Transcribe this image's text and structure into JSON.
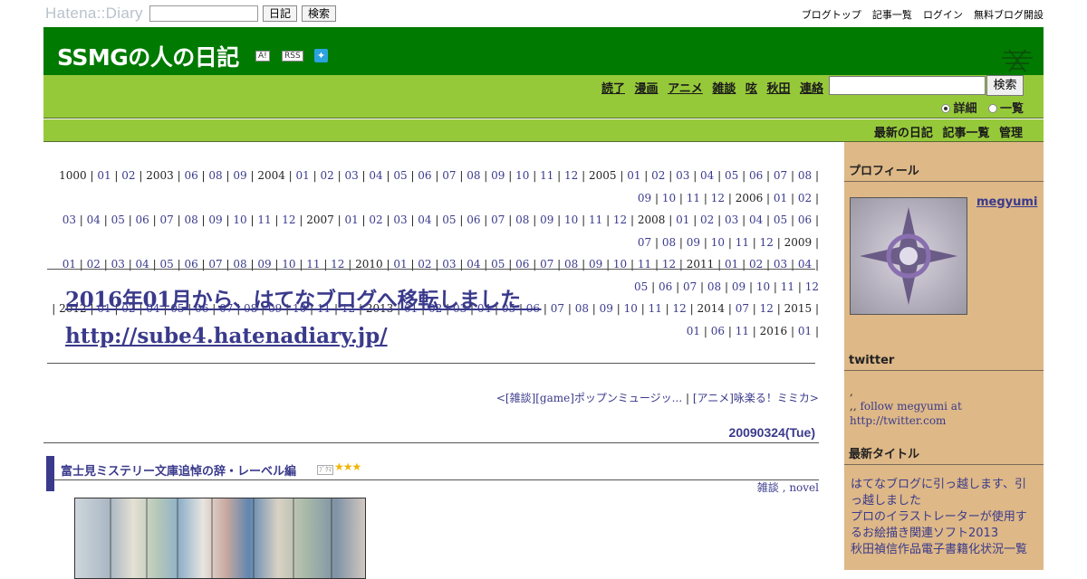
{
  "topbar": {
    "logo": "Hatena::Diary",
    "search_value": "",
    "diary_btn": "日記",
    "search_btn": "検索",
    "links": [
      "ブログトップ",
      "記事一覧",
      "ログイン",
      "無料ブログ開設"
    ]
  },
  "header": {
    "title": "SSMGの人の日記",
    "icon_a": "A!",
    "icon_rss": "RSS",
    "twitter_icon": "twitter-bird"
  },
  "nav": {
    "categories": [
      "読了",
      "漫画",
      "アニメ",
      "雑談",
      "呟",
      "秋田",
      "連絡"
    ],
    "search_value": "",
    "search_btn": "検索",
    "radio_detail": "詳細",
    "radio_list": "一覧",
    "selected_radio": "詳細"
  },
  "subnav": {
    "links": [
      "最新の日記",
      "記事一覧",
      "管理"
    ]
  },
  "calendar": {
    "lines": [
      [
        {
          "t": "1000 | "
        },
        {
          "a": "01"
        },
        {
          "t": " | "
        },
        {
          "a": "02"
        },
        {
          "t": " | 2003 | "
        },
        {
          "a": "06"
        },
        {
          "t": " | "
        },
        {
          "a": "08"
        },
        {
          "t": " | "
        },
        {
          "a": "09"
        },
        {
          "t": " | 2004 | "
        },
        {
          "a": "01"
        },
        {
          "t": " | "
        },
        {
          "a": "02"
        },
        {
          "t": " | "
        },
        {
          "a": "03"
        },
        {
          "t": " | "
        },
        {
          "a": "04"
        },
        {
          "t": " | "
        },
        {
          "a": "05"
        },
        {
          "t": " | "
        },
        {
          "a": "06"
        },
        {
          "t": " | "
        },
        {
          "a": "07"
        },
        {
          "t": " | "
        },
        {
          "a": "08"
        },
        {
          "t": " | "
        },
        {
          "a": "09"
        },
        {
          "t": " | "
        },
        {
          "a": "10"
        },
        {
          "t": " | "
        },
        {
          "a": "11"
        },
        {
          "t": " | "
        },
        {
          "a": "12"
        },
        {
          "t": " | 2005 | "
        },
        {
          "a": "01"
        },
        {
          "t": " | "
        },
        {
          "a": "02"
        },
        {
          "t": " | "
        },
        {
          "a": "03"
        },
        {
          "t": " | "
        },
        {
          "a": "04"
        },
        {
          "t": " | "
        },
        {
          "a": "05"
        },
        {
          "t": " | "
        },
        {
          "a": "06"
        },
        {
          "t": " | "
        },
        {
          "a": "07"
        },
        {
          "t": " | "
        },
        {
          "a": "08"
        },
        {
          "t": " | "
        },
        {
          "a": "09"
        },
        {
          "t": " | "
        },
        {
          "a": "10"
        },
        {
          "t": " | "
        },
        {
          "a": "11"
        },
        {
          "t": " | "
        },
        {
          "a": "12"
        },
        {
          "t": " | 2006 | "
        },
        {
          "a": "01"
        },
        {
          "t": " | "
        },
        {
          "a": "02"
        },
        {
          "t": " |"
        }
      ],
      [
        {
          "a": "03"
        },
        {
          "t": " | "
        },
        {
          "a": "04"
        },
        {
          "t": " | "
        },
        {
          "a": "05"
        },
        {
          "t": " | "
        },
        {
          "a": "06"
        },
        {
          "t": " | "
        },
        {
          "a": "07"
        },
        {
          "t": " | "
        },
        {
          "a": "08"
        },
        {
          "t": " | "
        },
        {
          "a": "09"
        },
        {
          "t": " | "
        },
        {
          "a": "10"
        },
        {
          "t": " | "
        },
        {
          "a": "11"
        },
        {
          "t": " | "
        },
        {
          "a": "12"
        },
        {
          "t": " | 2007 | "
        },
        {
          "a": "01"
        },
        {
          "t": " | "
        },
        {
          "a": "02"
        },
        {
          "t": " | "
        },
        {
          "a": "03"
        },
        {
          "t": " | "
        },
        {
          "a": "04"
        },
        {
          "t": " | "
        },
        {
          "a": "05"
        },
        {
          "t": " | "
        },
        {
          "a": "06"
        },
        {
          "t": " | "
        },
        {
          "a": "07"
        },
        {
          "t": " | "
        },
        {
          "a": "08"
        },
        {
          "t": " | "
        },
        {
          "a": "09"
        },
        {
          "t": " | "
        },
        {
          "a": "10"
        },
        {
          "t": " | "
        },
        {
          "a": "11"
        },
        {
          "t": " | "
        },
        {
          "a": "12"
        },
        {
          "t": " | 2008 | "
        },
        {
          "a": "01"
        },
        {
          "t": " | "
        },
        {
          "a": "02"
        },
        {
          "t": " | "
        },
        {
          "a": "03"
        },
        {
          "t": " | "
        },
        {
          "a": "04"
        },
        {
          "t": " | "
        },
        {
          "a": "05"
        },
        {
          "t": " | "
        },
        {
          "a": "06"
        },
        {
          "t": " | "
        },
        {
          "a": "07"
        },
        {
          "t": " | "
        },
        {
          "a": "08"
        },
        {
          "t": " | "
        },
        {
          "a": "09"
        },
        {
          "t": " | "
        },
        {
          "a": "10"
        },
        {
          "t": " | "
        },
        {
          "a": "11"
        },
        {
          "t": " | "
        },
        {
          "a": "12"
        },
        {
          "t": " | 2009 |"
        }
      ],
      [
        {
          "a": "01"
        },
        {
          "t": " | "
        },
        {
          "a": "02"
        },
        {
          "t": " | "
        },
        {
          "a": "03"
        },
        {
          "t": " | "
        },
        {
          "a": "04"
        },
        {
          "t": " | "
        },
        {
          "a": "05"
        },
        {
          "t": " | "
        },
        {
          "a": "06"
        },
        {
          "t": " | "
        },
        {
          "a": "07"
        },
        {
          "t": " | "
        },
        {
          "a": "08"
        },
        {
          "t": " | "
        },
        {
          "a": "09"
        },
        {
          "t": " | "
        },
        {
          "a": "10"
        },
        {
          "t": " | "
        },
        {
          "a": "11"
        },
        {
          "t": " | "
        },
        {
          "a": "12"
        },
        {
          "t": " | 2010 | "
        },
        {
          "a": "01"
        },
        {
          "t": " | "
        },
        {
          "a": "02"
        },
        {
          "t": " | "
        },
        {
          "a": "03"
        },
        {
          "t": " | "
        },
        {
          "a": "04"
        },
        {
          "t": " | "
        },
        {
          "a": "05"
        },
        {
          "t": " | "
        },
        {
          "a": "06"
        },
        {
          "t": " | "
        },
        {
          "a": "07"
        },
        {
          "t": " | "
        },
        {
          "a": "08"
        },
        {
          "t": " | "
        },
        {
          "a": "09"
        },
        {
          "t": " | "
        },
        {
          "a": "10"
        },
        {
          "t": " | "
        },
        {
          "a": "11"
        },
        {
          "t": " | "
        },
        {
          "a": "12"
        },
        {
          "t": " | 2011 | "
        },
        {
          "a": "01"
        },
        {
          "t": " | "
        },
        {
          "a": "02"
        },
        {
          "t": " | "
        },
        {
          "a": "03"
        },
        {
          "t": " | "
        },
        {
          "a": "04"
        },
        {
          "t": " | "
        },
        {
          "a": "05"
        },
        {
          "t": " | "
        },
        {
          "a": "06"
        },
        {
          "t": " | "
        },
        {
          "a": "07"
        },
        {
          "t": " | "
        },
        {
          "a": "08"
        },
        {
          "t": " | "
        },
        {
          "a": "09"
        },
        {
          "t": " | "
        },
        {
          "a": "10"
        },
        {
          "t": " | "
        },
        {
          "a": "11"
        },
        {
          "t": " | "
        },
        {
          "a": "12"
        }
      ],
      [
        {
          "t": "| 2012 | "
        },
        {
          "a": "01"
        },
        {
          "t": " | "
        },
        {
          "a": "02"
        },
        {
          "t": " | "
        },
        {
          "a": "04"
        },
        {
          "t": " | "
        },
        {
          "a": "05"
        },
        {
          "t": " | "
        },
        {
          "a": "06"
        },
        {
          "t": " | "
        },
        {
          "a": "07"
        },
        {
          "t": " | "
        },
        {
          "a": "08"
        },
        {
          "t": " | "
        },
        {
          "a": "09"
        },
        {
          "t": " | "
        },
        {
          "a": "10"
        },
        {
          "t": " | "
        },
        {
          "a": "11"
        },
        {
          "t": " | "
        },
        {
          "a": "12"
        },
        {
          "t": " | 2013 | "
        },
        {
          "a": "01"
        },
        {
          "t": " | "
        },
        {
          "a": "02"
        },
        {
          "t": " | "
        },
        {
          "a": "03"
        },
        {
          "t": " | "
        },
        {
          "a": "04"
        },
        {
          "t": " | "
        },
        {
          "a": "05"
        },
        {
          "t": " | "
        },
        {
          "a": "06"
        },
        {
          "t": " | "
        },
        {
          "a": "07"
        },
        {
          "t": " | "
        },
        {
          "a": "08"
        },
        {
          "t": " | "
        },
        {
          "a": "09"
        },
        {
          "t": " | "
        },
        {
          "a": "10"
        },
        {
          "t": " | "
        },
        {
          "a": "11"
        },
        {
          "t": " | "
        },
        {
          "a": "12"
        },
        {
          "t": " | 2014 | "
        },
        {
          "a": "07"
        },
        {
          "t": " | "
        },
        {
          "a": "12"
        },
        {
          "t": " | 2015 | "
        },
        {
          "a": "01"
        },
        {
          "t": " | "
        },
        {
          "a": "06"
        },
        {
          "t": " | "
        },
        {
          "a": "11"
        },
        {
          "t": " | 2016 | "
        },
        {
          "a": "01"
        },
        {
          "t": " |"
        }
      ]
    ]
  },
  "notice": {
    "line1": "2016年01月から、はてなブログへ移転しました　",
    "line2": "http://sube4.hatenadiary.jp/"
  },
  "pager": {
    "prev": "<[雑談][game]ポップンミュージッ...",
    "separator": " | ",
    "next": "[アニメ]咏楽る！ミミカ>"
  },
  "day": {
    "date": "20090324(Tue)"
  },
  "entry": {
    "title": "富士見ミステリー文庫追悼の辞・レーベル編",
    "badge": "ﾌﾞｸﾏ",
    "stars": "★★★",
    "categories": "雑談 , novel",
    "image_label": "book-photo"
  },
  "sidebar": {
    "profile_heading": "プロフィール",
    "profile_name": "megyumi",
    "twitter_heading": "twitter",
    "twitter_line1": ",",
    "twitter_prefix": ",, ",
    "twitter_link": "follow megyumi at http://twitter.com",
    "recent_heading": "最新タイトル",
    "recent_items": [
      "はてなブログに引っ越します、引っ越しました",
      "プロのイラストレーターが使用するお絵描き関連ソフト2013",
      "秋田禎信作品電子書籍化状況一覧"
    ]
  },
  "colors": {
    "header_green": "#007a00",
    "nav_green": "#96c93a",
    "sidebar_tan": "#deb887",
    "link_purple": "#3a3a8c"
  }
}
